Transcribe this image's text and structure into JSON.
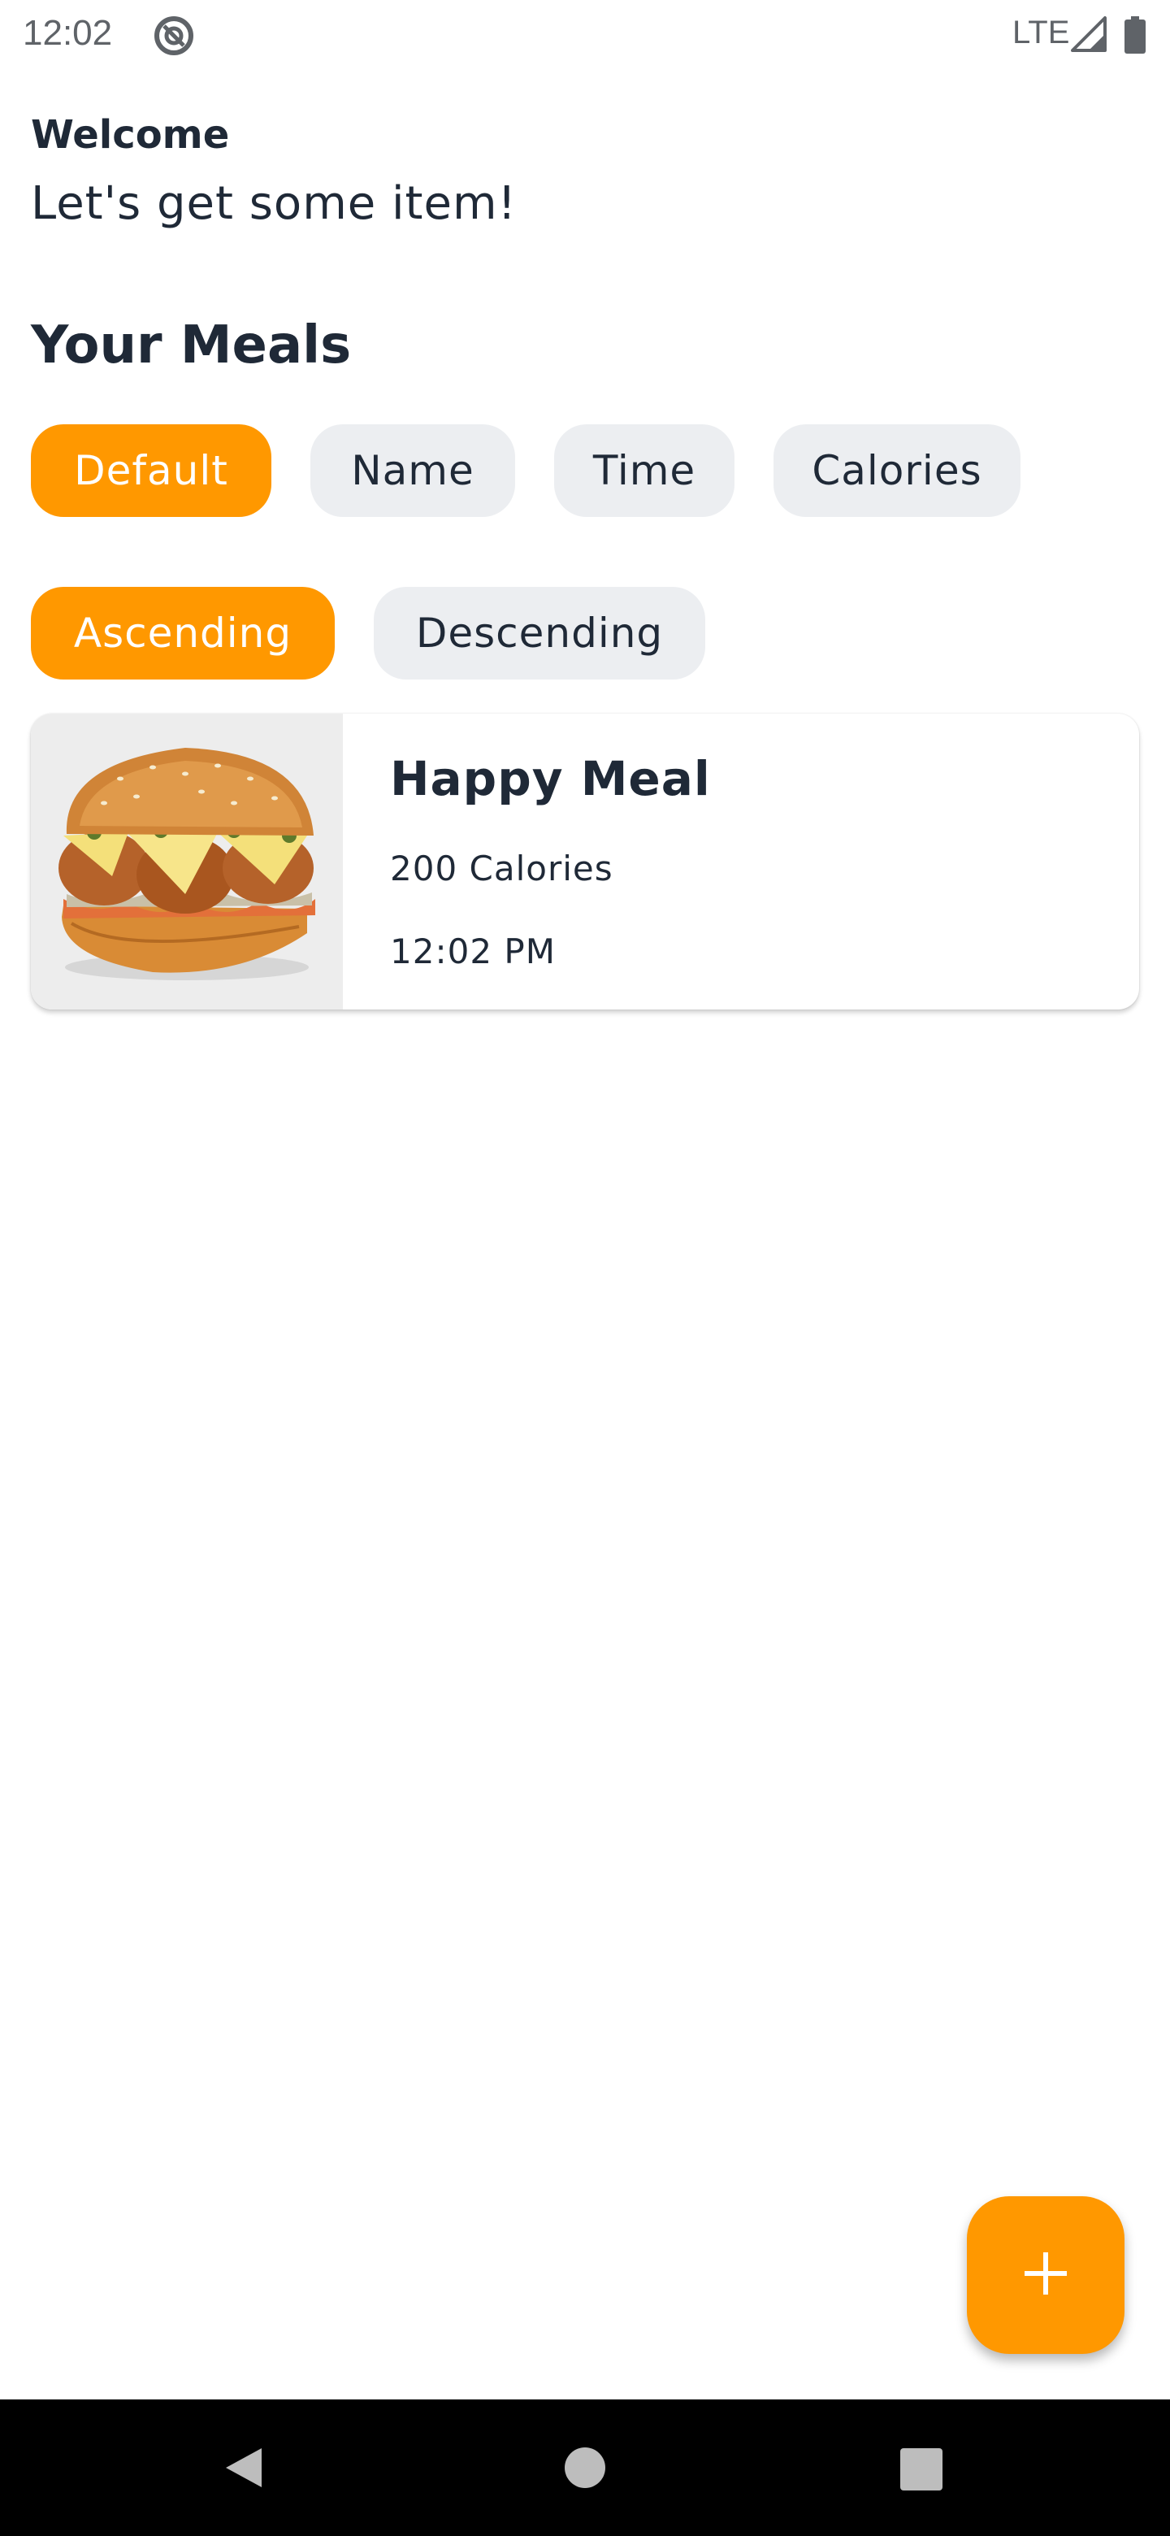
{
  "status_bar": {
    "time": "12:02",
    "network": "LTE",
    "icons": [
      "app-notification-icon",
      "signal-icon",
      "battery-icon"
    ]
  },
  "header": {
    "welcome": "Welcome",
    "subtitle": "Let's get some item!"
  },
  "section_title": "Your Meals",
  "sort_by": {
    "options": [
      "Default",
      "Name",
      "Time",
      "Calories"
    ],
    "selected": "Default"
  },
  "order": {
    "options": [
      "Ascending",
      "Descending"
    ],
    "selected": "Ascending"
  },
  "meals": [
    {
      "name": "Happy Meal",
      "calories": "200 Calories",
      "time": "12:02 PM",
      "image": "burger-sandwich-image"
    }
  ],
  "fab": {
    "icon": "plus-icon"
  },
  "nav_bar": {
    "icons": [
      "back-icon",
      "home-icon",
      "recents-icon"
    ]
  },
  "colors": {
    "accent": "#ff9800",
    "chip_bg": "#eceef1",
    "text": "#1f2937"
  }
}
